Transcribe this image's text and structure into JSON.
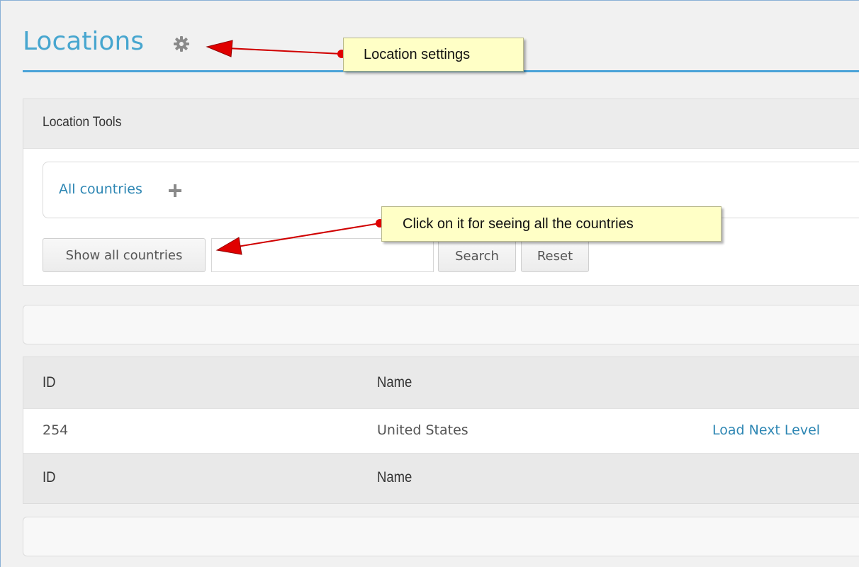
{
  "header": {
    "title": "Locations",
    "settings_icon": "gear-icon"
  },
  "tools": {
    "panel_title": "Location Tools",
    "breadcrumb_label": "All countries",
    "breadcrumb_icon": "plus-icon",
    "show_all_label": "Show all countries",
    "search_value": "",
    "search_label": "Search",
    "reset_label": "Reset"
  },
  "table": {
    "columns": [
      "ID",
      "Name"
    ],
    "rows": [
      {
        "id": "254",
        "name": "United States",
        "action": "Load Next Level"
      }
    ],
    "footer_columns": [
      "ID",
      "Name"
    ]
  },
  "annotations": [
    {
      "text": "Location settings"
    },
    {
      "text": "Click on it for seeing all the countries"
    }
  ],
  "colors": {
    "accent": "#47a6cf",
    "link": "#2d86b3",
    "callout_bg": "#ffffc6",
    "arrow": "#e00000"
  }
}
